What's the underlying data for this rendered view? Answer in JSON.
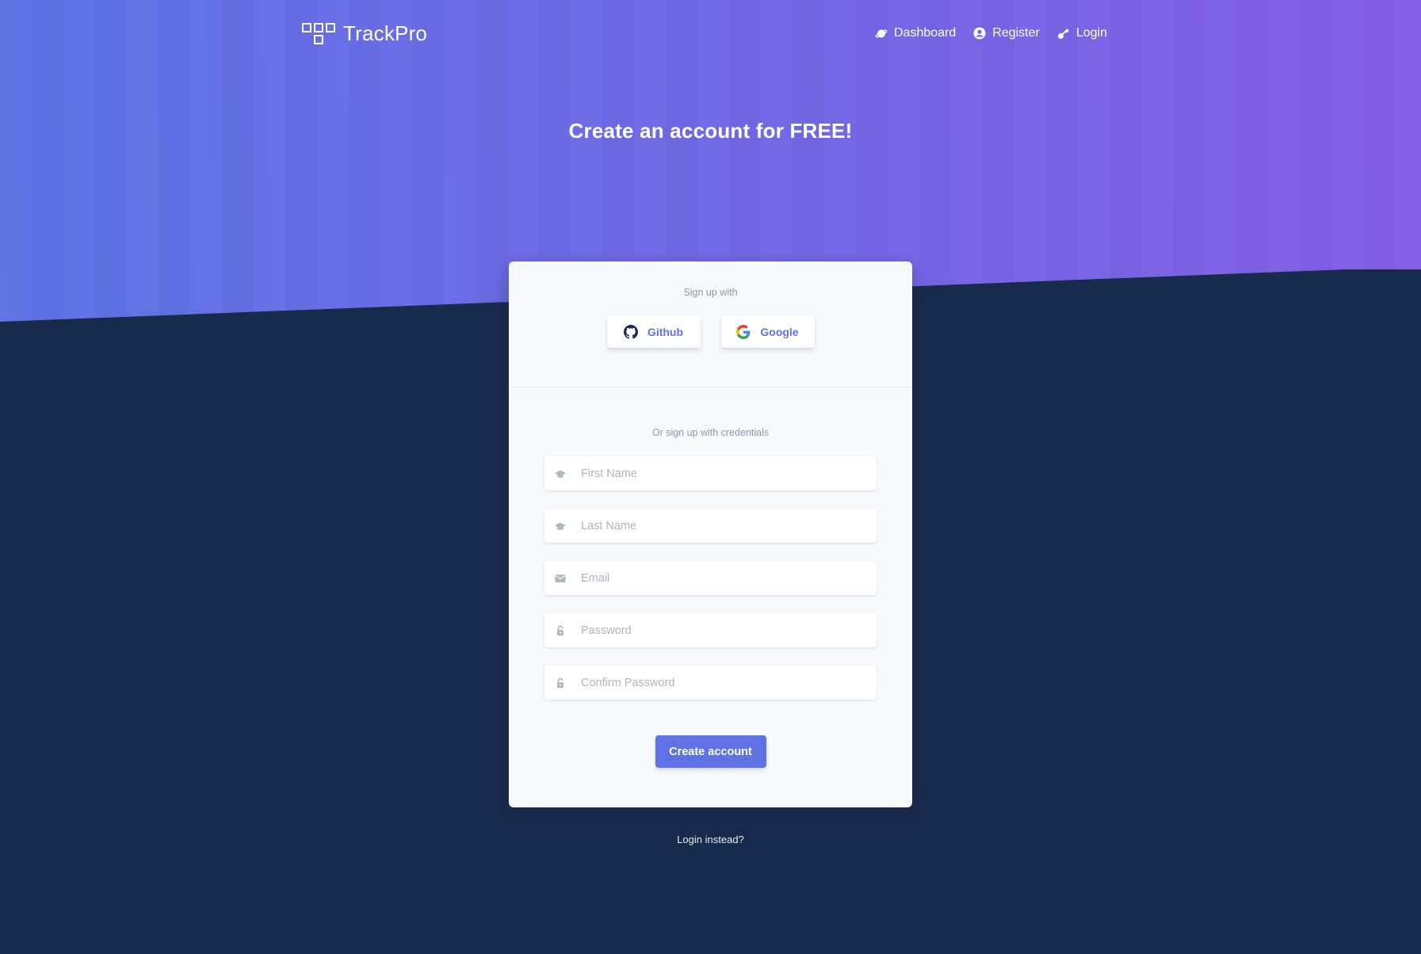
{
  "brand": {
    "name": "TrackPro",
    "icon": "grid-squares-logo"
  },
  "nav": [
    {
      "label": "Dashboard",
      "icon": "planet-icon"
    },
    {
      "label": "Register",
      "icon": "user-circle-icon"
    },
    {
      "label": "Login",
      "icon": "key-icon"
    }
  ],
  "hero": {
    "title": "Create an account for FREE!"
  },
  "card": {
    "social_heading": "Sign up with",
    "social": [
      {
        "label": "Github",
        "icon": "github-icon"
      },
      {
        "label": "Google",
        "icon": "google-icon"
      }
    ],
    "credentials_heading": "Or sign up with credentials",
    "fields": [
      {
        "placeholder": "First Name",
        "value": "",
        "icon": "hat-icon"
      },
      {
        "placeholder": "Last Name",
        "value": "",
        "icon": "hat-icon"
      },
      {
        "placeholder": "Email",
        "value": "",
        "icon": "email-icon"
      },
      {
        "placeholder": "Password",
        "value": "",
        "icon": "lock-icon"
      },
      {
        "placeholder": "Confirm Password",
        "value": "",
        "icon": "lock-icon"
      }
    ],
    "submit_label": "Create account"
  },
  "footer": {
    "login_instead": "Login instead?"
  },
  "colors": {
    "gradient_start": "#5e72e4",
    "gradient_end": "#825ee4",
    "background": "#172b4d",
    "card": "#f7fafc",
    "primary": "#5e72e4"
  }
}
